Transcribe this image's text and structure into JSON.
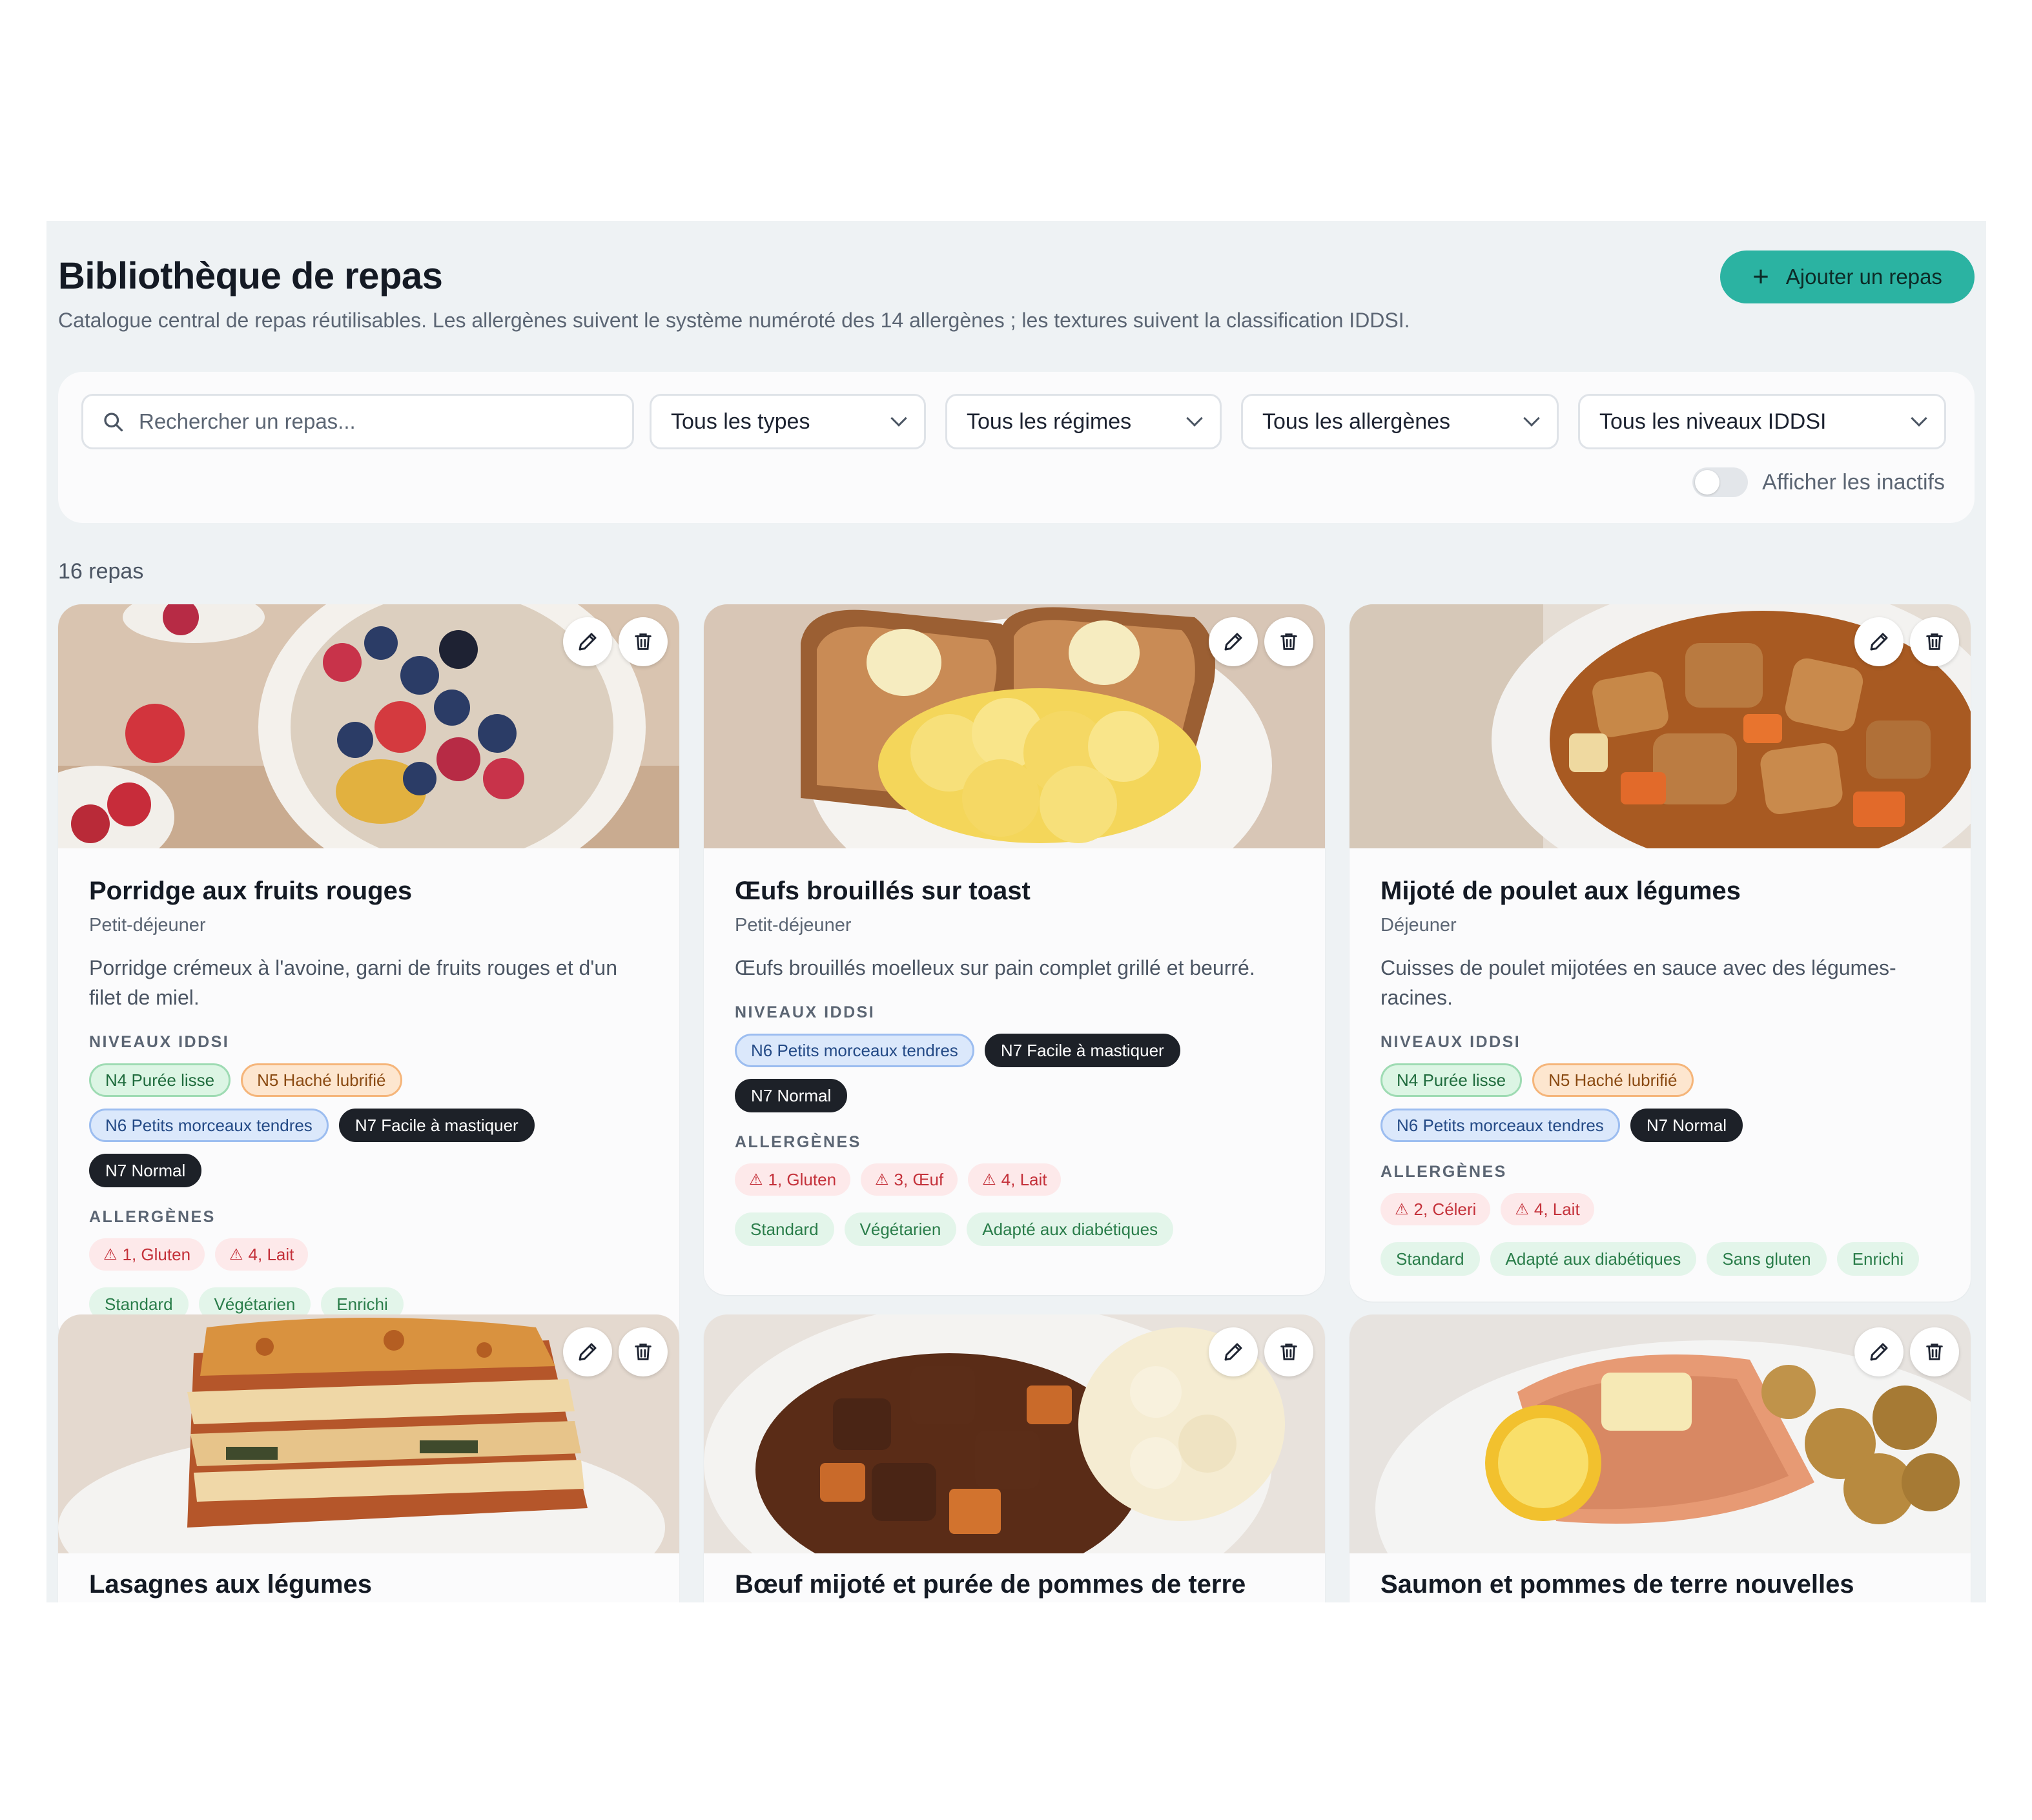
{
  "header": {
    "title": "Bibliothèque de repas",
    "subtitle": "Catalogue central de repas réutilisables. Les allergènes suivent le système numéroté des 14 allergènes ; les textures suivent la classification IDDSI.",
    "add_button": "Ajouter un repas"
  },
  "filters": {
    "search_placeholder": "Rechercher un repas...",
    "types": "Tous les types",
    "diets": "Tous les régimes",
    "allergens": "Tous les allergènes",
    "iddsi": "Tous les niveaux IDDSI",
    "show_inactive_label": "Afficher les inactifs",
    "show_inactive": false
  },
  "count_label": "16 repas",
  "section_labels": {
    "iddsi": "NIVEAUX IDDSI",
    "allergens": "ALLERGÈNES"
  },
  "colors": {
    "accent": "#2bb3a2",
    "background": "#eef2f4",
    "allergen_text": "#c4313a"
  },
  "icons": {
    "edit": "pencil-icon",
    "delete": "trash-icon",
    "warning": "warning-triangle-icon",
    "search": "search-icon",
    "add": "plus-icon"
  },
  "meals": [
    {
      "name": "Porridge aux fruits rouges",
      "type": "Petit-déjeuner",
      "description": "Porridge crémeux à l'avoine, garni de fruits rouges et d'un filet de miel.",
      "iddsi": [
        "N4 Purée lisse",
        "N5 Haché lubrifié",
        "N6 Petits morceaux tendres",
        "N7 Facile à mastiquer",
        "N7 Normal"
      ],
      "allergens": [
        "1, Gluten",
        "4, Lait"
      ],
      "diets": [
        "Standard",
        "Végétarien",
        "Enrichi"
      ]
    },
    {
      "name": "Œufs brouillés sur toast",
      "type": "Petit-déjeuner",
      "description": "Œufs brouillés moelleux sur pain complet grillé et beurré.",
      "iddsi": [
        "N6 Petits morceaux tendres",
        "N7 Facile à mastiquer",
        "N7 Normal"
      ],
      "allergens": [
        "1, Gluten",
        "3, Œuf",
        "4, Lait"
      ],
      "diets": [
        "Standard",
        "Végétarien",
        "Adapté aux diabétiques"
      ]
    },
    {
      "name": "Mijoté de poulet aux légumes",
      "type": "Déjeuner",
      "description": "Cuisses de poulet mijotées en sauce avec des légumes-racines.",
      "iddsi": [
        "N4 Purée lisse",
        "N5 Haché lubrifié",
        "N6 Petits morceaux tendres",
        "N7 Normal"
      ],
      "allergens": [
        "2, Céleri",
        "4, Lait"
      ],
      "diets": [
        "Standard",
        "Adapté aux diabétiques",
        "Sans gluten",
        "Enrichi"
      ]
    },
    {
      "name": "Lasagnes aux légumes"
    },
    {
      "name": "Bœuf mijoté et purée de pommes de terre"
    },
    {
      "name": "Saumon et pommes de terre nouvelles"
    }
  ]
}
